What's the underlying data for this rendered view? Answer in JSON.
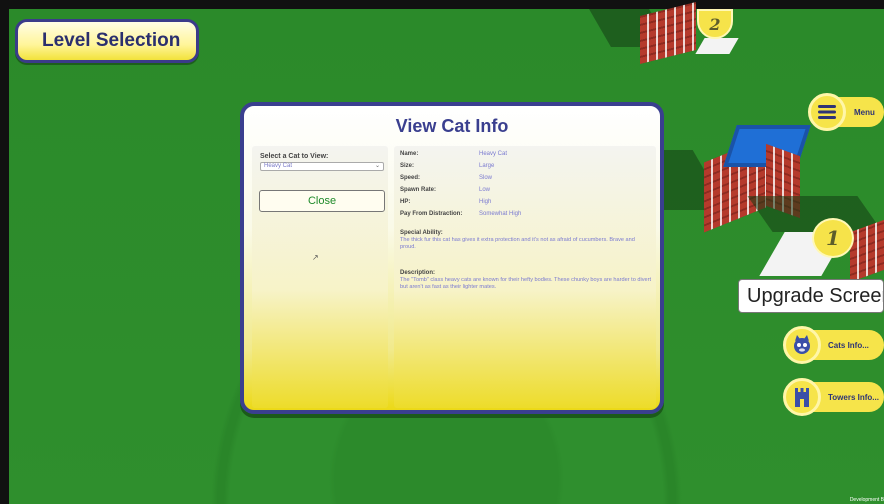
{
  "header": {
    "level_selection_label": "Level Selection"
  },
  "map": {
    "pin_2": "2",
    "pin_1": "1"
  },
  "modal": {
    "title": "View Cat Info",
    "select_label": "Select a Cat to View:",
    "selected_cat": "Heavy Cat",
    "close_label": "Close",
    "stats": [
      {
        "label": "Name:",
        "value": "Heavy Cat"
      },
      {
        "label": "Size:",
        "value": "Large"
      },
      {
        "label": "Speed:",
        "value": "Slow"
      },
      {
        "label": "Spawn Rate:",
        "value": "Low"
      },
      {
        "label": "HP:",
        "value": "High"
      },
      {
        "label": "Pay From Distraction:",
        "value": "Somewhat High"
      }
    ],
    "special_ability_title": "Special Ability:",
    "special_ability_text": "The thick fur this cat has gives it extra protection and it's not as afraid of cucumbers. Brave and proud.",
    "description_title": "Description:",
    "description_text": "The \"Tomb\" class heavy cats are known for their hefty bodies. These chunky boys are harder to divert but aren't as fast as their lighter mates."
  },
  "sidebar": {
    "menu_label": "Menu",
    "upgrade_label": "Upgrade Screen",
    "cats_info_label": "Cats Info...",
    "towers_info_label": "Towers Info..."
  },
  "footer": {
    "dev_label": "Development B"
  },
  "colors": {
    "accent": "#3a3f8f",
    "button_yellow": "#f6e44a",
    "value_text": "#7a7ad0",
    "close_text": "#1e8a2a"
  }
}
